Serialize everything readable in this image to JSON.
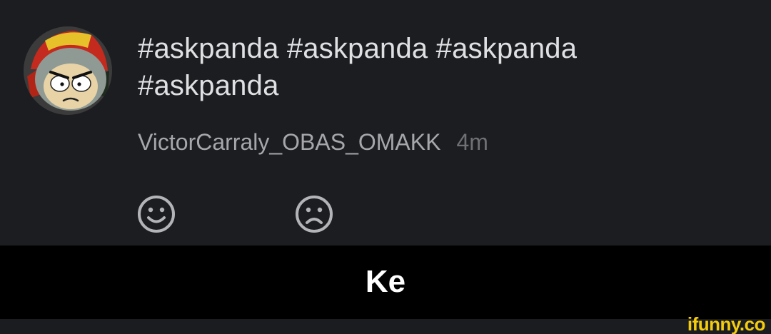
{
  "comment": {
    "avatar_icon": "cartoon-character-avatar",
    "text": "#askpanda #askpanda #askpanda #askpanda",
    "username": "VictorCarraly_OBAS_OMAKK",
    "timestamp": "4m",
    "reactions": [
      {
        "icon": "smile-icon"
      },
      {
        "icon": "frown-icon"
      }
    ]
  },
  "caption": {
    "text": "Ke"
  },
  "watermark": {
    "text": "ifunny.co"
  },
  "colors": {
    "background": "#1c1d21",
    "comment_text": "#dfe0e2",
    "meta_text": "#9c9da1",
    "icon_stroke": "#b3b4b8",
    "caption_background": "#000000",
    "caption_text": "#ffffff",
    "watermark": "#f4cc0c"
  }
}
